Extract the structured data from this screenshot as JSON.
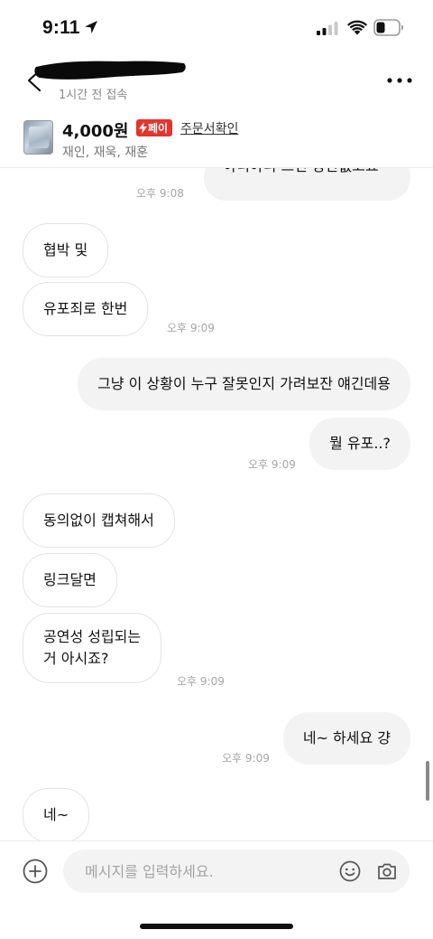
{
  "status_bar": {
    "time": "9:11",
    "icons": [
      "location-arrow-icon",
      "cellular-signal-icon",
      "wifi-icon",
      "battery-icon"
    ]
  },
  "header": {
    "last_seen": "1시간 전 접속",
    "back_icon": "chevron-left-icon",
    "more_icon": "more-dots-icon"
  },
  "product": {
    "price": "4,000원",
    "pay_badge": "페이",
    "order_link": "주문서확인",
    "subtitle": "재인, 재욱, 재훈"
  },
  "messages": [
    {
      "side": "out",
      "text": "아니아니 그건 상관없고요~",
      "time": "오후 9:08"
    },
    {
      "side": "in",
      "text": "협박 및",
      "time": ""
    },
    {
      "side": "in",
      "text": "유포죄로 한번",
      "time": "오후 9:09"
    },
    {
      "side": "out",
      "text": "그냥 이 상황이 누구 잘못인지 가려보잔 얘긴데용",
      "time": ""
    },
    {
      "side": "out",
      "text": "뭘 유포..?",
      "time": "오후 9:09"
    },
    {
      "side": "in",
      "text": "동의없이 캡쳐해서",
      "time": ""
    },
    {
      "side": "in",
      "text": "링크달면",
      "time": ""
    },
    {
      "side": "in",
      "text": "공연성 성립되는\n거 아시죠?",
      "time": "오후 9:09"
    },
    {
      "side": "out",
      "text": "네~ 하세요 걍",
      "time": "오후 9:09"
    },
    {
      "side": "in",
      "text": "네~",
      "time": ""
    }
  ],
  "input": {
    "placeholder": "메시지를 입력하세요."
  },
  "colors": {
    "accent_red": "#e5342b",
    "incoming_bubble": "#ffffff",
    "outgoing_bubble": "#f3f3f3",
    "timestamp": "#a6a6a6"
  }
}
